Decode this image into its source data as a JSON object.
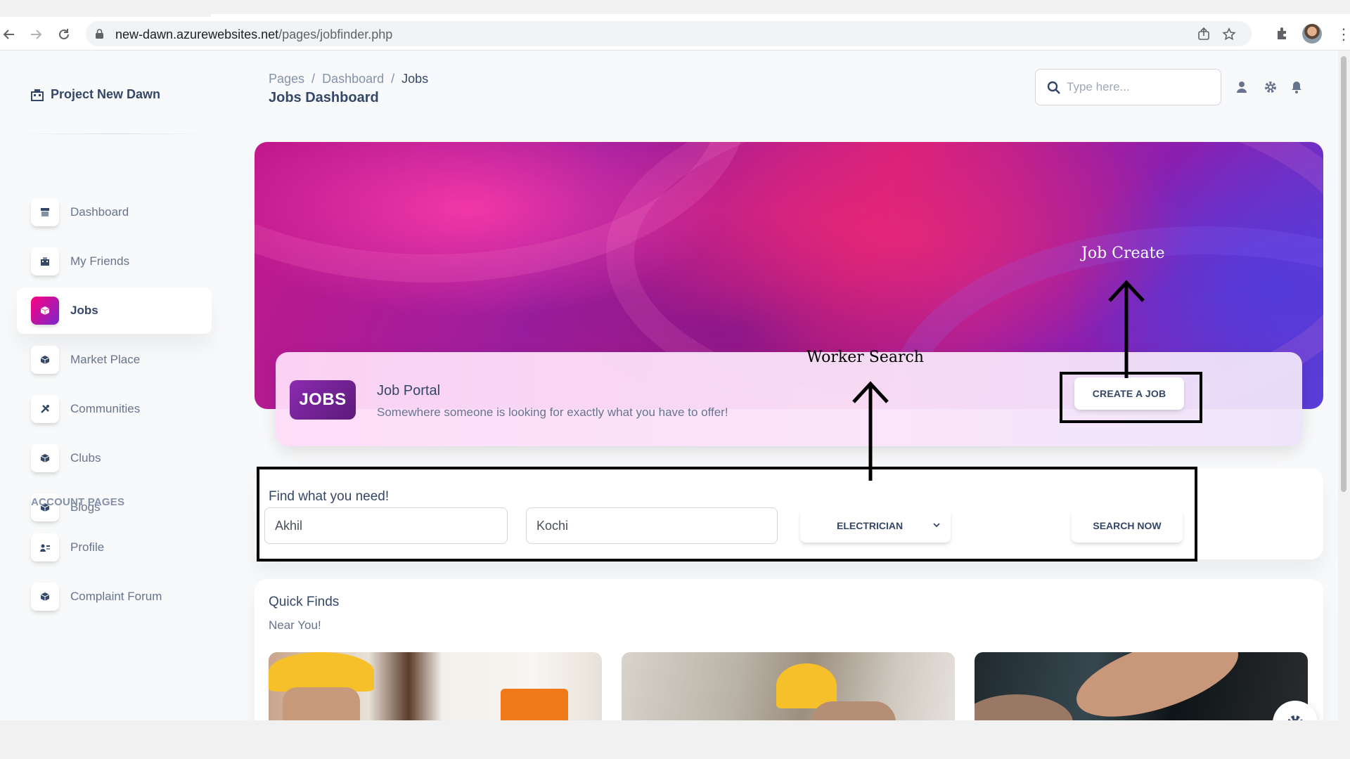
{
  "browser": {
    "url_host": "new-dawn.azurewebsites.net",
    "url_path": "/pages/jobfinder.php"
  },
  "sidebar": {
    "brand": "Project New Dawn",
    "items": [
      {
        "label": "Dashboard",
        "icon": "shop-icon"
      },
      {
        "label": "My Friends",
        "icon": "office-icon"
      },
      {
        "label": "Jobs",
        "icon": "box-icon",
        "active": true
      },
      {
        "label": "Market Place",
        "icon": "box-icon"
      },
      {
        "label": "Communities",
        "icon": "tools-icon"
      },
      {
        "label": "Clubs",
        "icon": "box-icon"
      },
      {
        "label": "Blogs",
        "icon": "box-icon"
      }
    ],
    "account_heading": "ACCOUNT PAGES",
    "account_items": [
      {
        "label": "Profile",
        "icon": "user-card-icon"
      },
      {
        "label": "Complaint Forum",
        "icon": "box-icon"
      }
    ]
  },
  "header": {
    "breadcrumb": [
      "Pages",
      "/",
      "Dashboard",
      "/",
      "Jobs"
    ],
    "title": "Jobs Dashboard",
    "search_placeholder": "Type here..."
  },
  "portal": {
    "logo_text": "JOBS",
    "title": "Job Portal",
    "subtitle": "Somewhere someone is looking for exactly what you have to offer!",
    "create_button": "CREATE A JOB"
  },
  "search": {
    "heading": "Find what you need!",
    "name_value": "Akhil",
    "location_value": "Kochi",
    "category_value": "ELECTRICIAN",
    "button": "SEARCH NOW"
  },
  "quick": {
    "title": "Quick Finds",
    "subtitle": "Near You!"
  },
  "annotations": {
    "job_create": "Job Create",
    "worker_search": "Worker Search"
  },
  "colors": {
    "accent_gradient_start": "#7928ca",
    "accent_gradient_end": "#ff0080",
    "text_primary": "#344767",
    "text_secondary": "#67748e"
  }
}
